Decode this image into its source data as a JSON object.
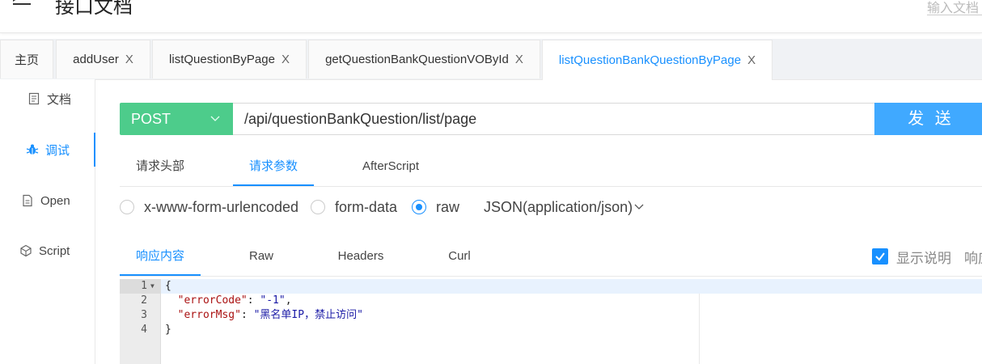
{
  "header": {
    "title": "接口文档",
    "search_placeholder": "输入文档"
  },
  "tabs": [
    {
      "label": "主页",
      "closable": false
    },
    {
      "label": "addUser",
      "closable": true
    },
    {
      "label": "listQuestionByPage",
      "closable": true
    },
    {
      "label": "getQuestionBankQuestionVOById",
      "closable": true
    },
    {
      "label": "listQuestionBankQuestionByPage",
      "closable": true,
      "active": true
    }
  ],
  "tab_close_glyph": "X",
  "sidebar": {
    "items": [
      {
        "label": "文档",
        "icon": "document-icon"
      },
      {
        "label": "调试",
        "icon": "bug-icon",
        "active": true
      },
      {
        "label": "Open",
        "icon": "file-icon"
      },
      {
        "label": "Script",
        "icon": "code-sandbox-icon"
      }
    ]
  },
  "request": {
    "method": "POST",
    "url": "/api/questionBankQuestion/list/page",
    "send_label": "发 送"
  },
  "request_tabs": [
    {
      "label": "请求头部"
    },
    {
      "label": "请求参数",
      "active": true
    },
    {
      "label": "AfterScript"
    }
  ],
  "body_types": [
    {
      "label": "x-www-form-urlencoded",
      "checked": false
    },
    {
      "label": "form-data",
      "checked": false
    },
    {
      "label": "raw",
      "checked": true
    }
  ],
  "content_type": "JSON(application/json)",
  "response_tabs": [
    {
      "label": "响应内容",
      "active": true
    },
    {
      "label": "Raw"
    },
    {
      "label": "Headers"
    },
    {
      "label": "Curl"
    }
  ],
  "show_description": {
    "label": "显示说明",
    "checked": true
  },
  "response_extra_label": "响应",
  "editor": {
    "line_numbers": [
      "1",
      "2",
      "3",
      "4"
    ],
    "lines": {
      "open": "{",
      "key1": "\"errorCode\"",
      "val1": "\"-1\"",
      "key2": "\"errorMsg\"",
      "val2": "\"黑名单IP，禁止访问\"",
      "close": "}"
    }
  },
  "colors": {
    "accent": "#1890ff",
    "method_bg": "#4dcc8b",
    "send_bg": "#40a9ff"
  }
}
